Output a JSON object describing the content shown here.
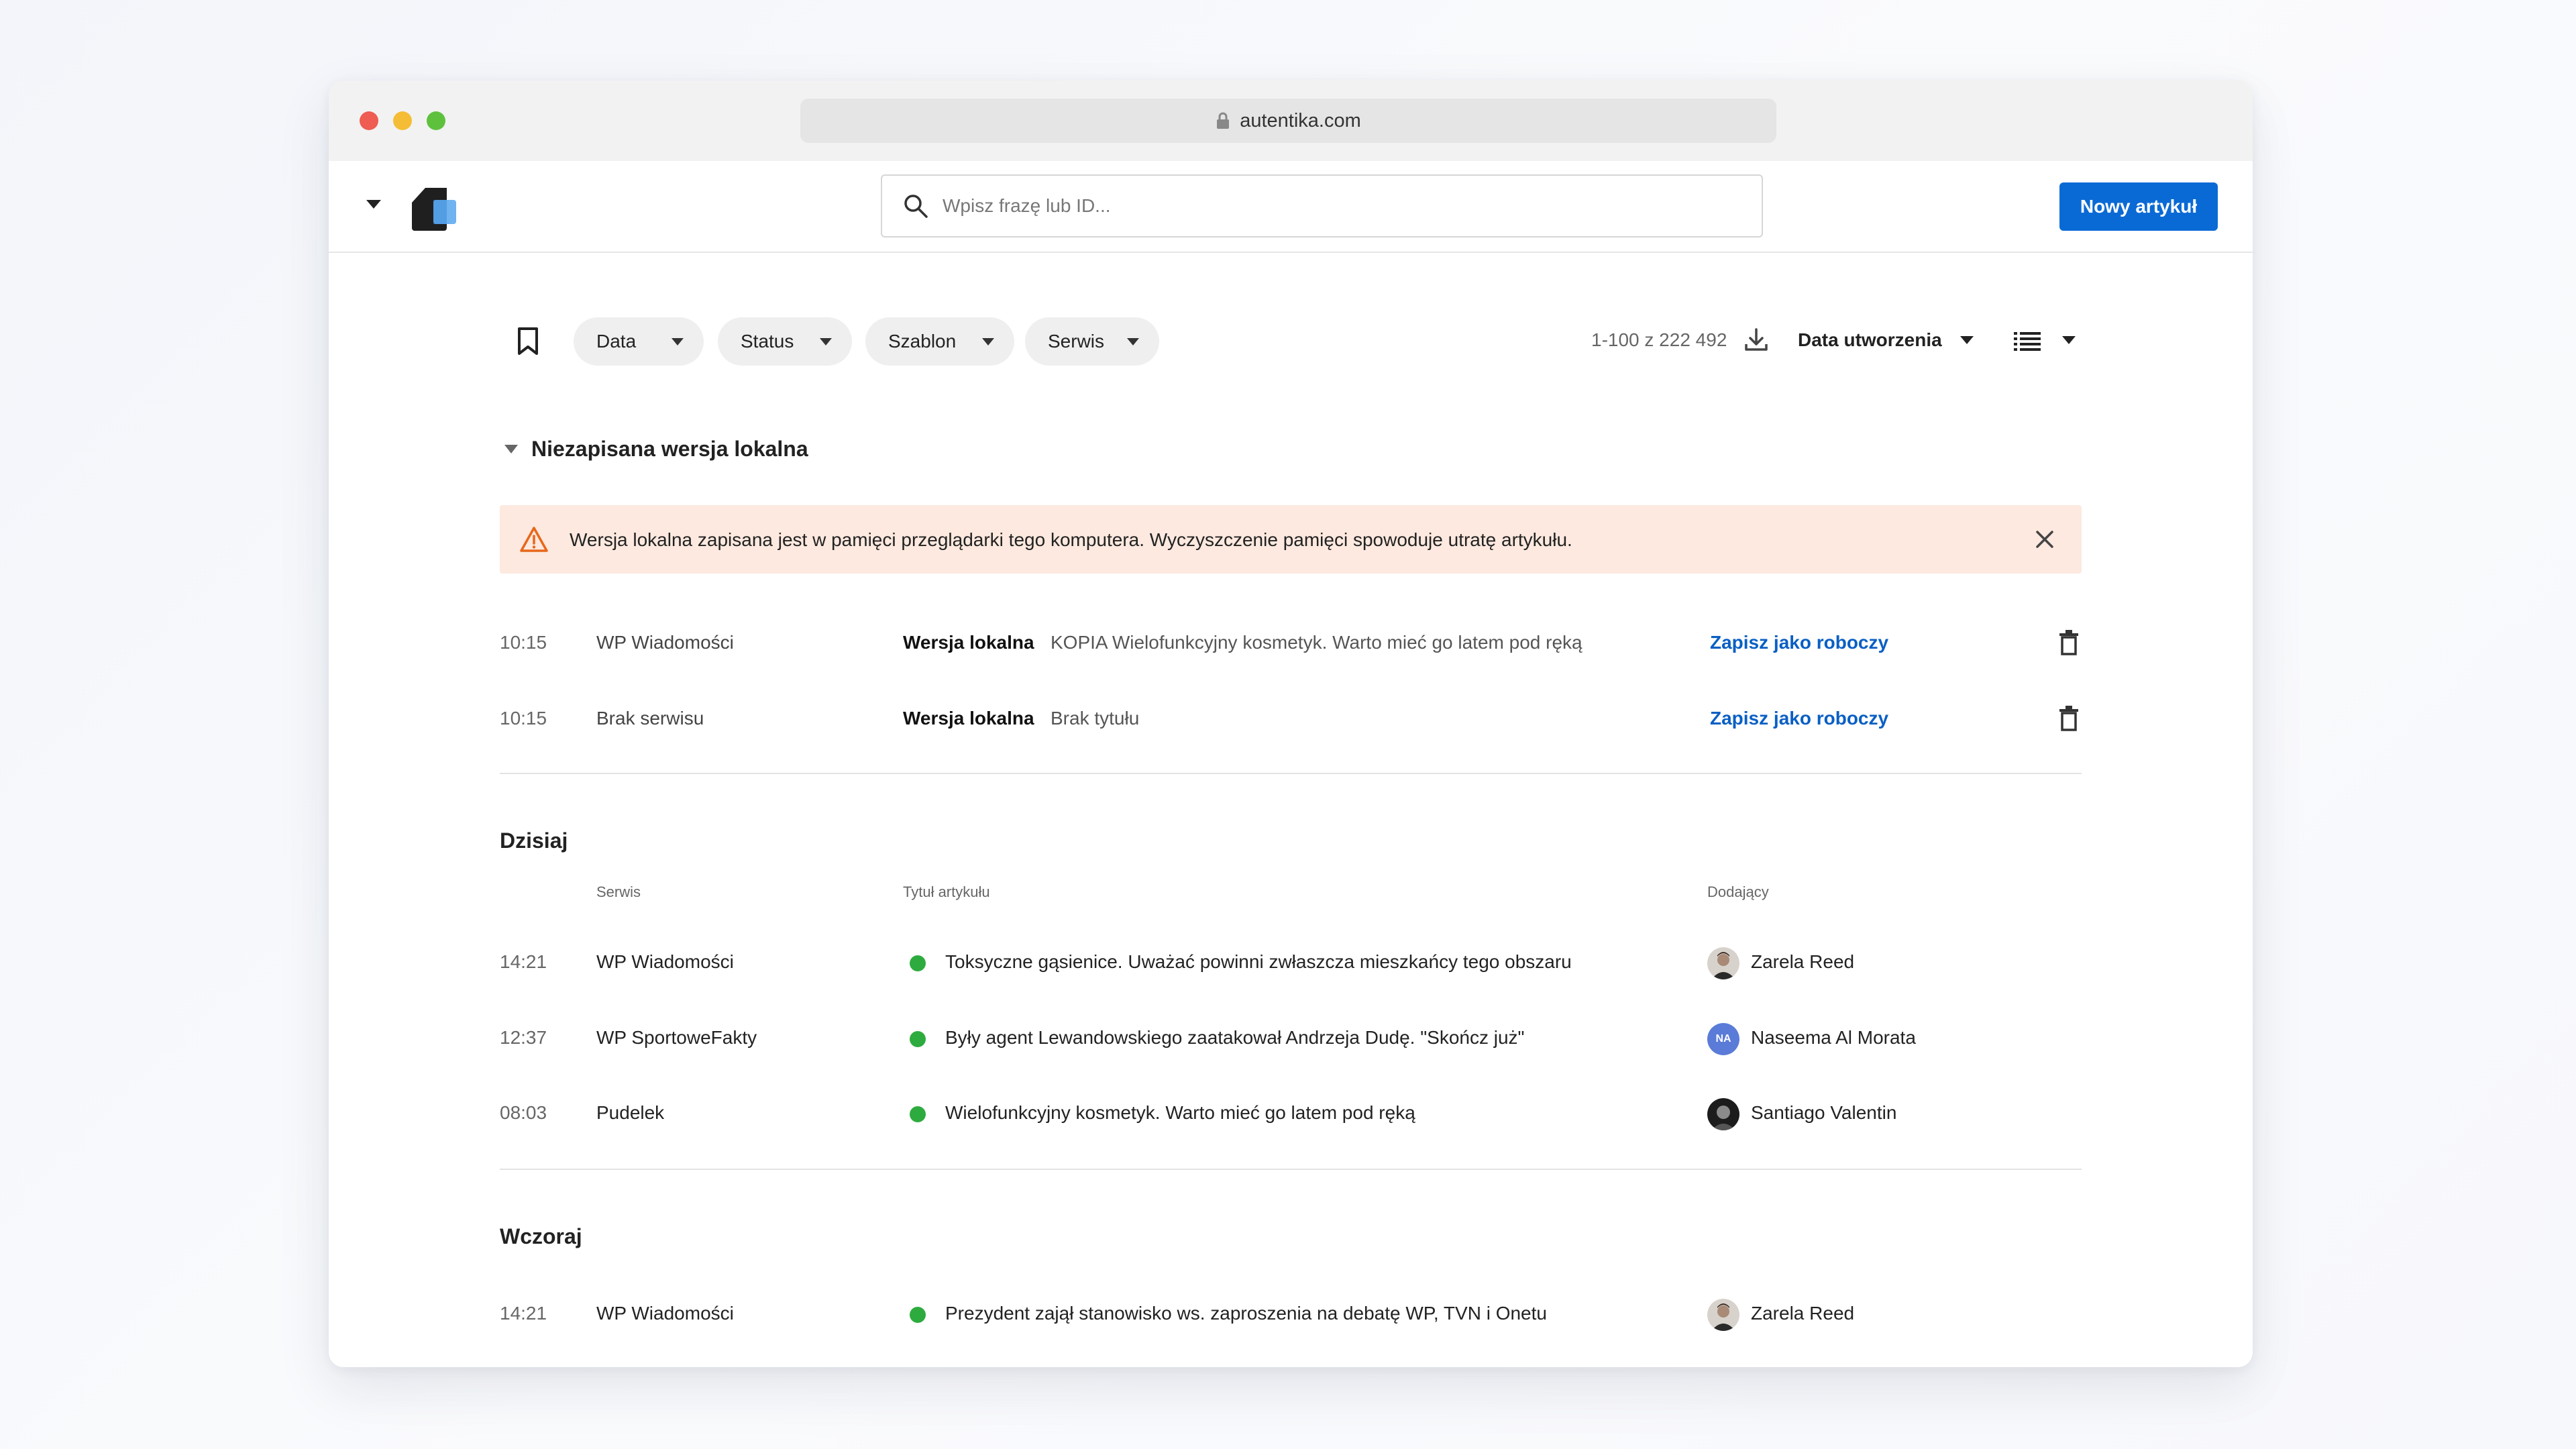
{
  "browser": {
    "url": "autentika.com"
  },
  "header": {
    "search_placeholder": "Wpisz frazę lub ID...",
    "new_button": "Nowy artykuł",
    "accent": "#0a6ad5"
  },
  "filters": {
    "chips": [
      "Data",
      "Status",
      "Szablon",
      "Serwis"
    ],
    "count": "1-100 z 222 492",
    "sort_label": "Data utworzenia"
  },
  "local": {
    "section_title": "Niezapisana wersja lokalna",
    "alert": "Wersja lokalna zapisana jest w pamięci przeglądarki tego komputera. Wyczyszczenie pamięci spowoduje utratę artykułu.",
    "tag": "Wersja lokalna",
    "save_label": "Zapisz jako roboczy",
    "rows": [
      {
        "time": "10:15",
        "serwis": "WP Wiadomości",
        "title": "KOPIA Wielofunkcyjny kosmetyk. Warto mieć go latem pod ręką"
      },
      {
        "time": "10:15",
        "serwis": "Brak serwisu",
        "title": "Brak tytułu"
      }
    ]
  },
  "columns": {
    "serwis": "Serwis",
    "title": "Tytuł artykułu",
    "author": "Dodający"
  },
  "today": {
    "title": "Dzisiaj",
    "rows": [
      {
        "time": "14:21",
        "serwis": "WP Wiadomości",
        "title": "Toksyczne gąsienice. Uważać powinni zwłaszcza mieszkańcy tego obszaru",
        "author": "Zarela Reed",
        "avatar": "photo"
      },
      {
        "time": "12:37",
        "serwis": "WP SportoweFakty",
        "title": "Były agent Lewandowskiego zaatakował Andrzeja Dudę. \"Skończ już\"",
        "author": "Naseema Al Morata",
        "avatar": "NA"
      },
      {
        "time": "08:03",
        "serwis": "Pudelek",
        "title": "Wielofunkcyjny kosmetyk. Warto mieć go latem pod ręką",
        "author": "Santiago Valentin",
        "avatar": "photo"
      }
    ]
  },
  "yesterday": {
    "title": "Wczoraj",
    "rows": [
      {
        "time": "14:21",
        "serwis": "WP Wiadomości",
        "title": "Prezydent zajął stanowisko ws. zaproszenia na debatę WP, TVN i Onetu",
        "author": "Zarela Reed",
        "avatar": "photo"
      }
    ]
  },
  "colors": {
    "status_published": "#2eab3f",
    "link": "#0a5fc4",
    "alert_bg": "#fde9df",
    "warning": "#e8671b"
  }
}
